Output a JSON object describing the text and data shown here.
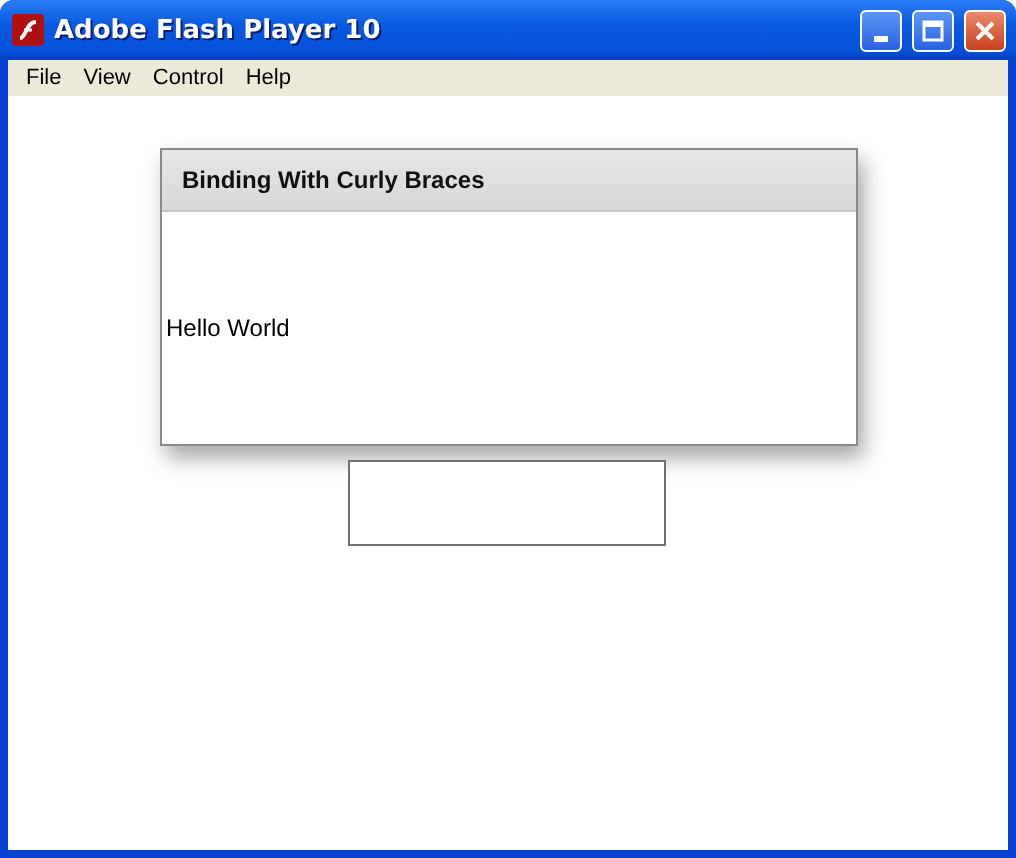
{
  "window": {
    "title": "Adobe Flash Player 10"
  },
  "menu": [
    "File",
    "View",
    "Control",
    "Help"
  ],
  "panel": {
    "title": "Binding With Curly Braces",
    "label": "Hello World"
  }
}
